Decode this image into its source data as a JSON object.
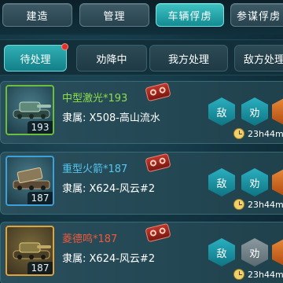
{
  "top_tabs": [
    {
      "label": "建造"
    },
    {
      "label": "管理"
    },
    {
      "label": "车辆俘虏"
    },
    {
      "label": "参谋俘虏"
    }
  ],
  "filter_tabs": [
    {
      "label": "待处理"
    },
    {
      "label": "劝降中"
    },
    {
      "label": "我方处理"
    },
    {
      "label": "敌方处理"
    }
  ],
  "captives": [
    {
      "name": "中型激光*193",
      "owner": "隶属: X508-高山流水",
      "level": "193",
      "timer": "23h44m",
      "buttons": [
        "敌",
        "劝",
        ""
      ],
      "name_color": "#8ee04a"
    },
    {
      "name": "重型火箭*187",
      "owner": "隶属: X624-风云#2",
      "level": "187",
      "timer": "23h44m",
      "buttons": [
        "敌",
        "劝",
        ""
      ],
      "name_color": "#55c6f0"
    },
    {
      "name": "菱德鸣*187",
      "owner": "隶属: X624-风云#2",
      "level": "187",
      "timer": "23h44m",
      "buttons": [
        "敌",
        "劝",
        ""
      ],
      "name_color": "#ee5a3a"
    }
  ],
  "colors": {
    "accent": "#2ab0c0",
    "alert": "#e0302a"
  }
}
